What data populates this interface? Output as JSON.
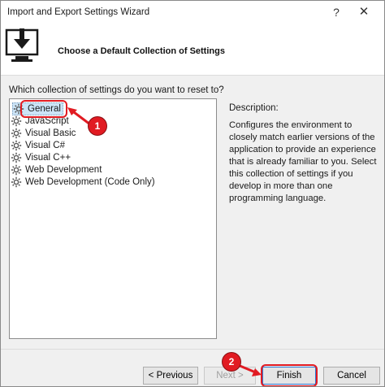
{
  "window": {
    "title": "Import and Export Settings Wizard",
    "help_label": "?",
    "close_label": "✕"
  },
  "header": {
    "title": "Choose a Default Collection of Settings",
    "icon": "download-to-monitor-icon"
  },
  "question": "Which collection of settings do you want to reset to?",
  "settings_list": {
    "items": [
      {
        "label": "General",
        "selected": true
      },
      {
        "label": "JavaScript",
        "selected": false
      },
      {
        "label": "Visual Basic",
        "selected": false
      },
      {
        "label": "Visual C#",
        "selected": false
      },
      {
        "label": "Visual C++",
        "selected": false
      },
      {
        "label": "Web Development",
        "selected": false
      },
      {
        "label": "Web Development (Code Only)",
        "selected": false
      }
    ]
  },
  "description": {
    "label": "Description:",
    "text": "Configures the environment to closely match earlier versions of the application to provide an experience that is already familiar to you. Select this collection of settings if you develop in more than one programming language."
  },
  "buttons": {
    "previous": "< Previous",
    "next": "Next >",
    "finish": "Finish",
    "cancel": "Cancel"
  },
  "annotations": {
    "step1": "1",
    "step2": "2",
    "color": "#e11b22"
  }
}
